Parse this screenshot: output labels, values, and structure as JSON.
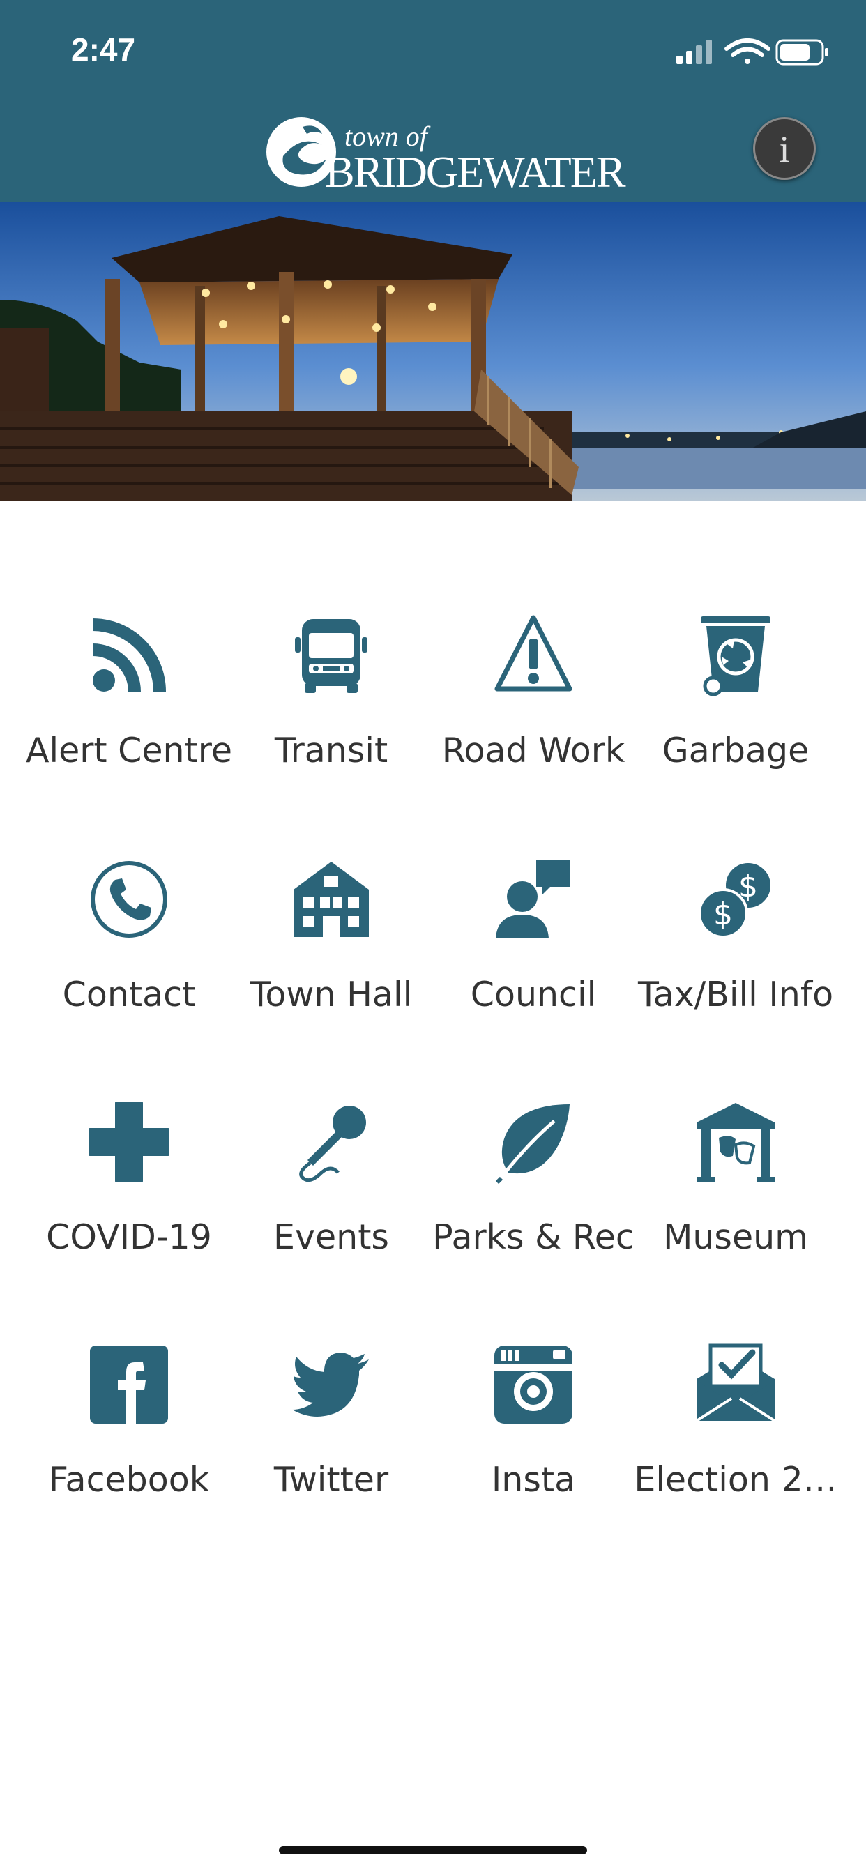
{
  "status": {
    "time": "2:47"
  },
  "header": {
    "logo_town": "town of",
    "logo_name": "BRIDGEWATER",
    "info_icon": "info-icon",
    "info_label": "i"
  },
  "hero": {
    "alt": "gazebo-at-dusk"
  },
  "tiles": [
    {
      "label": "Alert Centre",
      "icon": "rss-icon"
    },
    {
      "label": "Transit",
      "icon": "bus-icon"
    },
    {
      "label": "Road Work",
      "icon": "warning-icon"
    },
    {
      "label": "Garbage",
      "icon": "recycle-bin-icon"
    },
    {
      "label": "Contact",
      "icon": "phone-icon"
    },
    {
      "label": "Town Hall",
      "icon": "building-icon"
    },
    {
      "label": "Council",
      "icon": "speaker-icon"
    },
    {
      "label": "Tax/Bill Info",
      "icon": "dollar-coins-icon"
    },
    {
      "label": "COVID-19",
      "icon": "cross-icon"
    },
    {
      "label": "Events",
      "icon": "microphone-icon"
    },
    {
      "label": "Parks & Rec",
      "icon": "leaf-icon"
    },
    {
      "label": "Museum",
      "icon": "museum-icon"
    },
    {
      "label": "Facebook",
      "icon": "facebook-icon"
    },
    {
      "label": "Twitter",
      "icon": "twitter-icon"
    },
    {
      "label": "Insta",
      "icon": "instagram-icon"
    },
    {
      "label": "Election 2…",
      "icon": "ballot-envelope-icon"
    }
  ],
  "colors": {
    "brand": "#2b6479",
    "icon": "#2b6479",
    "text": "#333333"
  }
}
